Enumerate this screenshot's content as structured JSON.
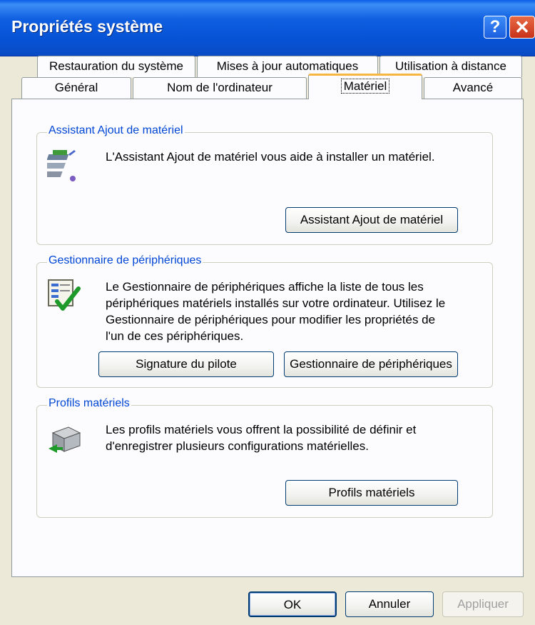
{
  "window": {
    "title": "Propriétés système",
    "help_label": "?",
    "close_label": "✕"
  },
  "tabs": {
    "row1": [
      {
        "label": "Restauration du système"
      },
      {
        "label": "Mises à jour automatiques"
      },
      {
        "label": "Utilisation à distance"
      }
    ],
    "row2": [
      {
        "label": "Général"
      },
      {
        "label": "Nom de l'ordinateur"
      },
      {
        "label": "Matériel",
        "active": true
      },
      {
        "label": "Avancé"
      }
    ]
  },
  "add_hardware": {
    "group_label": "Assistant Ajout de matériel",
    "description": "L'Assistant Ajout de matériel vous aide à installer un matériel.",
    "button_label": "Assistant Ajout de matériel"
  },
  "device_manager": {
    "group_label": "Gestionnaire de périphériques",
    "description_lines": [
      "Le Gestionnaire de périphériques affiche la liste de tous les",
      "périphériques matériels installés sur votre ordinateur. Utilisez le",
      "Gestionnaire de périphériques pour modifier les propriétés de",
      "l'un de ces périphériques."
    ],
    "signature_button_label": "Signature du pilote",
    "manager_button_label": "Gestionnaire de périphériques"
  },
  "hardware_profiles": {
    "group_label": "Profils matériels",
    "description_lines": [
      "Les profils matériels vous offrent la possibilité de définir et",
      "d'enregistrer plusieurs configurations matérielles."
    ],
    "button_label": "Profils matériels"
  },
  "footer": {
    "ok_label": "OK",
    "cancel_label": "Annuler",
    "apply_label": "Appliquer"
  },
  "colors": {
    "titlebar": "#0653d6",
    "group_label": "#0046d5",
    "active_tab_accent": "#f5b740"
  },
  "icons": [
    "help-icon",
    "close-icon",
    "add-hardware-wizard-icon",
    "device-manager-icon",
    "hardware-profiles-icon"
  ]
}
